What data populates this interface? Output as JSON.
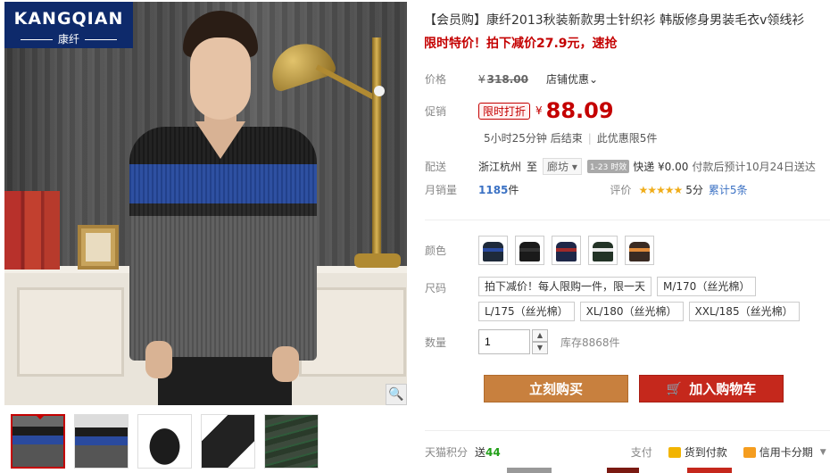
{
  "brand": {
    "name": "KANGQIAN",
    "sub": "康纤"
  },
  "product": {
    "title": "【会员购】康纤2013秋装新款男士针织衫 韩版修身男装毛衣v领线衫",
    "promo_line": "限时特价！拍下减价27.9元，速抢"
  },
  "price": {
    "label": "价格",
    "currency": "¥",
    "original": "318.00",
    "coupon_label": "店铺优惠",
    "coupon_arrow": "⌄"
  },
  "promo": {
    "label": "促销",
    "tag": "限时打折",
    "currency": "¥",
    "price": "88.09",
    "countdown": "5小时25分钟 后结束",
    "limit": "此优惠限5件"
  },
  "shipping": {
    "label": "配送",
    "from": "浙江杭州",
    "to_word": "至",
    "to": "廊坊",
    "to_arrow": "▾",
    "express_badge": "1-23 时效",
    "express": "快递 ¥0.00",
    "eta": "付款后预计10月24日送达"
  },
  "sales": {
    "label": "月销量",
    "count": "1185",
    "unit": "件",
    "rating_label": "评价",
    "stars": "★★★★★",
    "score": "5分",
    "reviews": "累计5条"
  },
  "color": {
    "label": "颜色",
    "swatches": [
      {
        "name": "black-navy"
      },
      {
        "name": "black"
      },
      {
        "name": "navy-red"
      },
      {
        "name": "green-white"
      },
      {
        "name": "brown-orange"
      }
    ]
  },
  "size": {
    "label": "尺码",
    "options": [
      "拍下减价！每人限购一件，限一天",
      "M/170（丝光棉）",
      "L/175（丝光棉）",
      "XL/180（丝光棉）",
      "XXL/185（丝光棉）"
    ]
  },
  "quantity": {
    "label": "数量",
    "value": "1",
    "up": "▲",
    "down": "▼",
    "stock": "库存8868件"
  },
  "actions": {
    "buy": "立刻购买",
    "cart": "加入购物车",
    "cart_icon": "🛒"
  },
  "footer": {
    "points_label": "天猫积分",
    "points_prefix": "送",
    "points_value": "44",
    "pay_label": "支付",
    "pay_cod": "货到付款",
    "pay_card": "信用卡分期",
    "pay_arrow": "▼"
  },
  "zoom_icon": "🔍",
  "colors": {
    "accent_red": "#c40000",
    "buy_button": "#c8803e",
    "cart_button": "#c5281c",
    "link_blue": "#3c72c4",
    "points_green": "#22a018",
    "brand_navy": "#0e2a6b"
  }
}
